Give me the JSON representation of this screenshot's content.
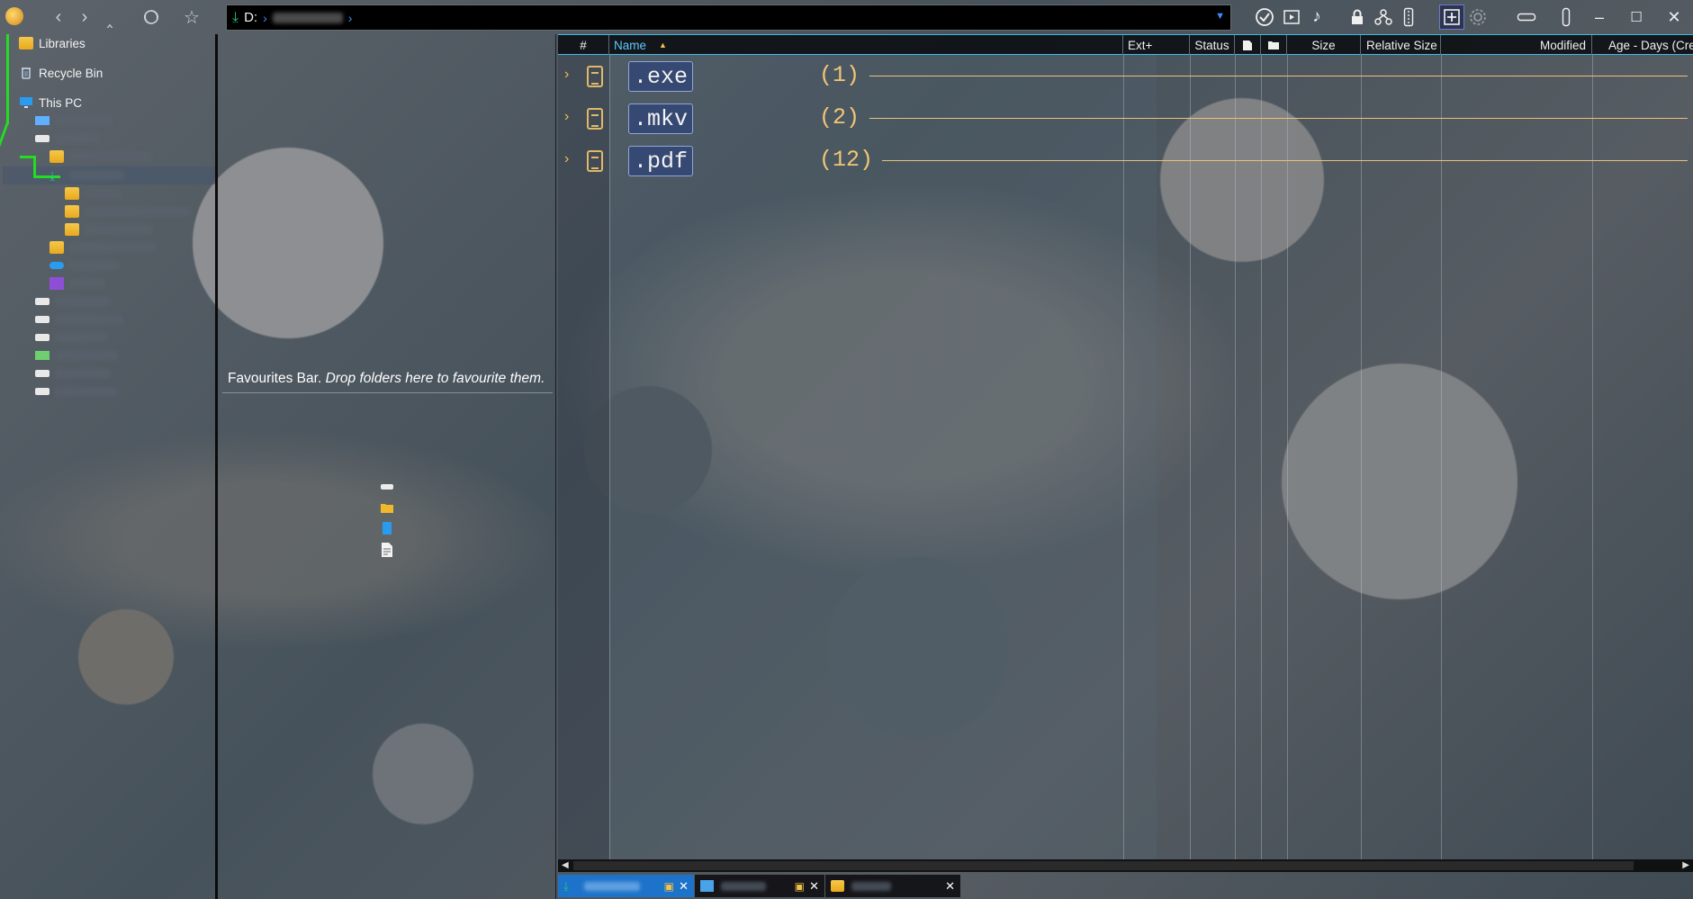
{
  "address": {
    "drive": "D:",
    "dropdown_icon": "chevron-down-icon"
  },
  "toolbar": {
    "icons": [
      "app-icon",
      "back-icon",
      "forward-icon",
      "up-icon",
      "refresh-icon",
      "star-icon",
      "checkmark-icon",
      "video-icon",
      "music-icon",
      "lock-icon",
      "branch-icon",
      "zip-icon",
      "add-panel-icon",
      "settings-icon",
      "horizontal-layout-icon",
      "vertical-layout-icon"
    ]
  },
  "window": {
    "minimize": "–",
    "maximize": "☐",
    "close": "✕"
  },
  "tree": {
    "items": [
      {
        "label": "Libraries",
        "icon": "folder-icon"
      },
      {
        "label": "Recycle Bin",
        "icon": "recycle-bin-icon"
      },
      {
        "label": "This PC",
        "icon": "monitor-icon"
      }
    ]
  },
  "favourites": {
    "label": "Favourites Bar.",
    "hint": "Drop folders here to favourite them."
  },
  "columns": {
    "num": "#",
    "name": "Name",
    "ext": "Ext+",
    "status": "Status",
    "size": "Size",
    "relative_size": "Relative Size",
    "modified": "Modified",
    "age": "Age - Days (Cre"
  },
  "groups": [
    {
      "ext": ".exe",
      "count": "(1)"
    },
    {
      "ext": ".mkv",
      "count": "(2)"
    },
    {
      "ext": ".pdf",
      "count": "(12)"
    }
  ],
  "colors": {
    "accent": "#3cbde6",
    "group_count": "#f2c673",
    "tab_active": "#1d73c9"
  }
}
